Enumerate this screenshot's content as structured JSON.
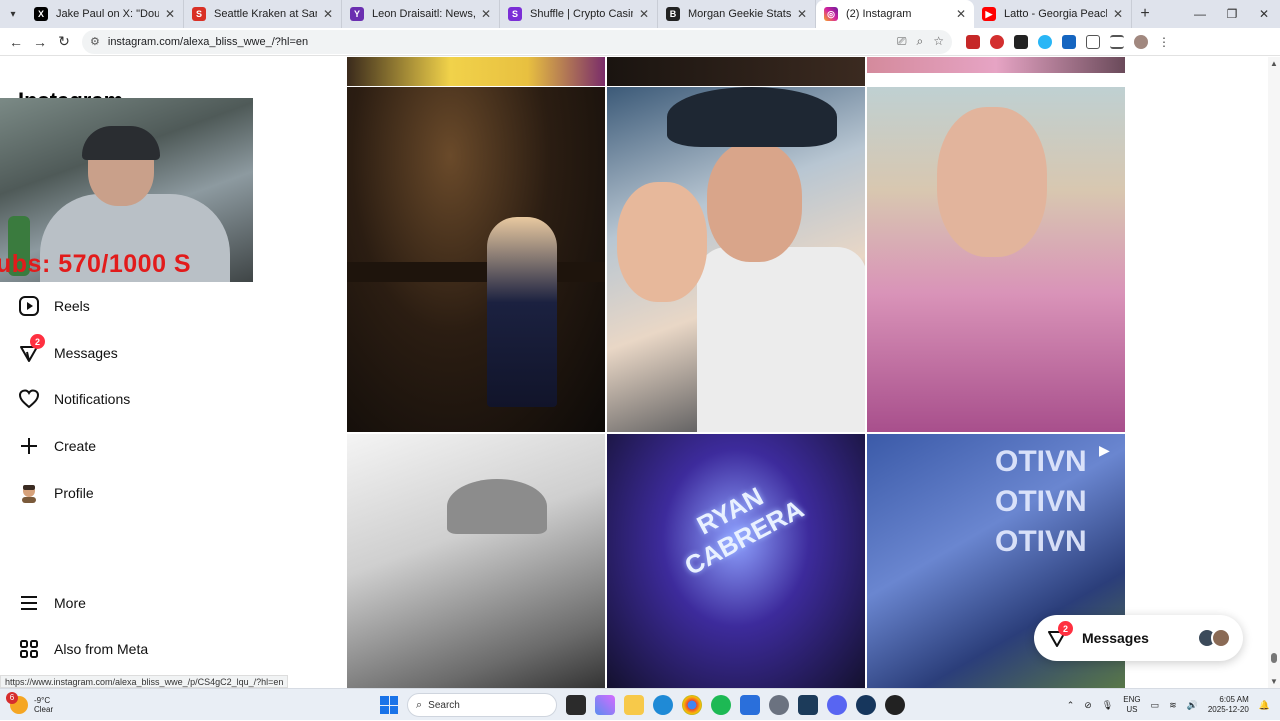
{
  "browser": {
    "tabs": [
      {
        "title": "Jake Paul on X: \"Double broken",
        "fav_color": "#000000",
        "fav_glyph": "X"
      },
      {
        "title": "Seattle Kraken at San Jose Shar",
        "fav_color": "#d93025",
        "fav_glyph": "S"
      },
      {
        "title": "Leon Draisaitl: News, Stats, Gar",
        "fav_color": "#6b2fb0",
        "fav_glyph": "Y"
      },
      {
        "title": "Shuffle | Crypto Casino & Bitco",
        "fav_color": "#7b2ed6",
        "fav_glyph": "S"
      },
      {
        "title": "Morgan Geekie Stats And News",
        "fav_color": "#222222",
        "fav_glyph": "B"
      },
      {
        "title": "(2) Instagram",
        "fav_color": "#d6249f",
        "fav_glyph": "◎",
        "active": true
      },
      {
        "title": "Latto - Georgia Peach (Official",
        "fav_color": "#ff0000",
        "fav_glyph": "▶"
      }
    ],
    "url": "instagram.com/alexa_bliss_wwe_/?hl=en",
    "status_url": "https://www.instagram.com/alexa_bliss_wwe_/p/CS4gC2_lqu_/?hl=en"
  },
  "sidebar": {
    "hidden_heading": "Instagram",
    "items": [
      {
        "label": "Reels",
        "icon": "reels-icon"
      },
      {
        "label": "Messages",
        "icon": "messenger-icon",
        "badge": "2"
      },
      {
        "label": "Notifications",
        "icon": "heart-icon"
      },
      {
        "label": "Create",
        "icon": "plus-icon"
      },
      {
        "label": "Profile",
        "icon": "avatar-icon"
      },
      {
        "label": "More",
        "icon": "menu-icon"
      },
      {
        "label": "Also from Meta",
        "icon": "meta-grid-icon"
      }
    ]
  },
  "webcam": {
    "overlay_text": "ubs: 570/1000  S"
  },
  "posts": {
    "concert_sign": "RYAN CABRERA",
    "stage_text": "OTIVN OTIVN OTIVN"
  },
  "messages_float": {
    "label": "Messages",
    "badge": "2"
  },
  "taskbar": {
    "weather_badge": "6",
    "temperature": "-9°C",
    "condition": "Clear",
    "search_label": "Search",
    "lang1": "ENG",
    "lang2": "US",
    "time": "6:05 AM",
    "date": "2025-12-20"
  }
}
